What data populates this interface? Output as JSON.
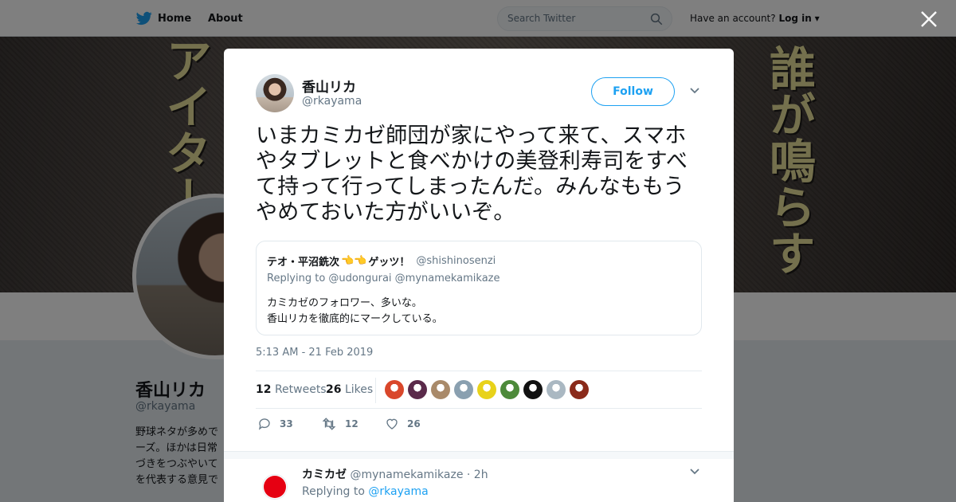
{
  "header": {
    "home_label": "Home",
    "about_label": "About",
    "search_placeholder": "Search Twitter",
    "account_prompt": "Have an account?",
    "login_label": "Log in"
  },
  "profile": {
    "name": "香山リカ",
    "handle": "@rkayama",
    "bio_lines": [
      "野球ネタが多めで",
      "ーズ。ほかは日常",
      "づきをつぶやいて",
      "を代表する意見で"
    ],
    "banner_text": [
      "アイターズ",
      "誰が鳴らす"
    ]
  },
  "tweet": {
    "author_name": "香山リカ",
    "author_handle": "@rkayama",
    "follow_label": "Follow",
    "text": "いまカミカゼ師団が家にやって来て、スマホやタブレットと食べかけの美登利寿司をすべて持って行ってしまったんだ。みんなももうやめておいた方がいいぞ。",
    "timestamp": "5:13 AM - 21 Feb 2019",
    "quoted": {
      "author_name": "テオ・平沼銑次",
      "author_name_suffix": "ゲッツ！",
      "author_handle": "@shishinosenzi",
      "replying_to": "Replying to @udongurai @mynamekamikaze",
      "body_lines": [
        "カミカゼのフォロワー、多いな。",
        "香山リカを徹底的にマークしている。"
      ]
    },
    "stats": {
      "retweets_count": "12",
      "retweets_label": "Retweets",
      "likes_count": "26",
      "likes_label": "Likes"
    },
    "actions": {
      "reply_count": "33",
      "retweet_count": "12",
      "like_count": "26"
    },
    "liker_colors": [
      "#d9472b",
      "#5a2a4a",
      "#a98a6a",
      "#8aa0b0",
      "#e8d21a",
      "#4d8a3a",
      "#111111",
      "#aab8c2",
      "#8a2a1a"
    ]
  },
  "reply": {
    "author_name": "カミカゼ",
    "author_handle": "@mynamekamikaze",
    "time": "· 2h",
    "replying_prefix": "Replying to",
    "replying_handle": "@rkayama"
  },
  "colors": {
    "accent": "#1da1f2",
    "text": "#14171a",
    "muted": "#657786",
    "reply_avatar_red": "#e60012"
  }
}
